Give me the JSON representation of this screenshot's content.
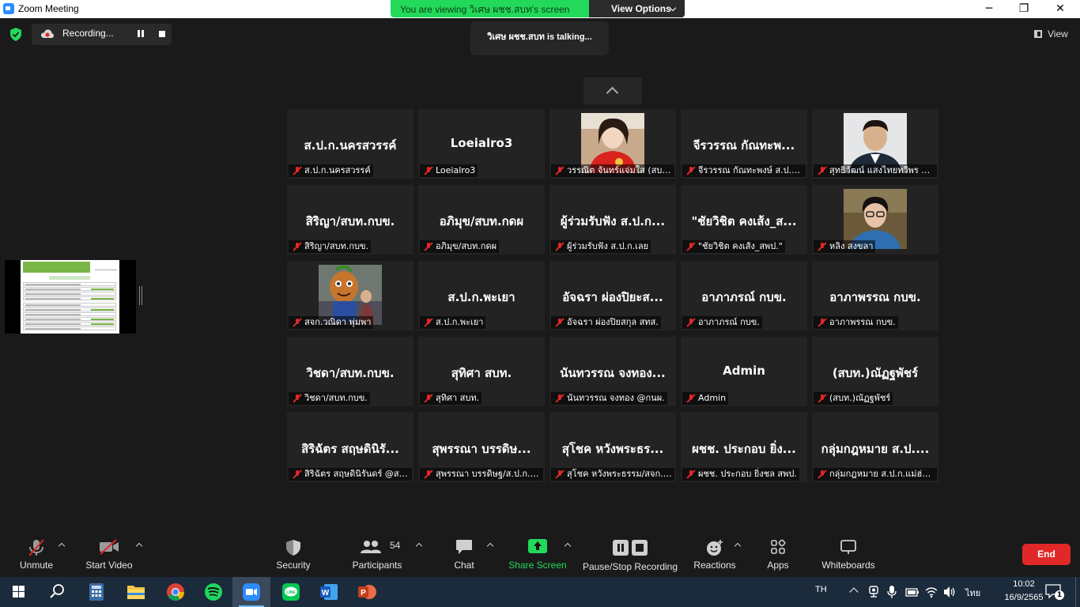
{
  "window": {
    "title": "Zoom Meeting",
    "minimize": "─",
    "restore": "❐",
    "close": "✕"
  },
  "viewing_banner": {
    "message": "You are viewing วิเศษ ผชช.สบท's screen",
    "view_options": "View Options"
  },
  "recording": {
    "label": "Recording..."
  },
  "talking_indicator": "วิเศษ ผชช.สบท is talking...",
  "view_button": "View",
  "participants": [
    {
      "name": "ส.ป.ก.นครสวรรค์",
      "label": "ส.ป.ก.นครสวรรค์",
      "video": false
    },
    {
      "name": "Loeialro3",
      "label": "Loeialro3",
      "video": false
    },
    {
      "name": "",
      "label": "วรรณิต จันทร์แจ่มใส (สบท.สป...",
      "video": true,
      "photo": "red-shirt-woman"
    },
    {
      "name": "จีรวรรณ กัณทะพ...",
      "label": "จีรวรรณ กัณทะพงษ์ ส.ป.ก.เชียง...",
      "video": false
    },
    {
      "name": "",
      "label": "สุทธิวัฒน์ แสงไทยทวีพร ส.ป.ก...",
      "video": true,
      "photo": "man-in-suit"
    },
    {
      "name": "สิริญา/สบท.กบข.",
      "label": "สิริญา/สบท.กบข.",
      "video": false
    },
    {
      "name": "อภิมุข/สบท.กดผ",
      "label": "อภิมุข/สบท.กดผ",
      "video": false
    },
    {
      "name": "ผู้ร่วมรับฟัง ส.ป.ก...",
      "label": "ผู้ร่วมรับฟัง ส.ป.ก.เลย",
      "video": false
    },
    {
      "name": "\"ชัยวิชิต คงเส้ง_ส...",
      "label": "\"ชัยวิชิต คงเส้ง_สพป.\"",
      "video": false
    },
    {
      "name": "",
      "label": "หลิง สงขลา",
      "video": true,
      "photo": "woman-glasses"
    },
    {
      "name": "",
      "label": "สจก.วณิดา พุ่มพา",
      "video": true,
      "photo": "mascot"
    },
    {
      "name": "ส.ป.ก.พะเยา",
      "label": "ส.ป.ก.พะเยา",
      "video": false
    },
    {
      "name": "อัจฉรา ผ่องปิยะส...",
      "label": "อัจฉรา ผ่องปิยสกุล สทส.",
      "video": false
    },
    {
      "name": "อาภาภรณ์ กบข.",
      "label": "อาภาภรณ์ กบข.",
      "video": false
    },
    {
      "name": "อาภาพรรณ กบข.",
      "label": "อาภาพรรณ กบข.",
      "video": false
    },
    {
      "name": "วิชดา/สบท.กบข.",
      "label": "วิชดา/สบท.กบข.",
      "video": false
    },
    {
      "name": "สุทิศา สบท.",
      "label": "สุทิศา สบท.",
      "video": false
    },
    {
      "name": "นันทวรรณ จงทอง...",
      "label": "นันทวรรณ จงทอง @กนผ.",
      "video": false
    },
    {
      "name": "Admin",
      "label": "Admin",
      "video": false
    },
    {
      "name": "(สบท.)ณัฏฐพัชร์",
      "label": "(สบท.)ณัฏฐพัชร์",
      "video": false
    },
    {
      "name": "สิริฉัตร สฤษดินิรั...",
      "label": "สิริฉัตร สฤษดินิรันดร์ @สกส.",
      "video": false
    },
    {
      "name": "สุพรรณา บรรดิษ...",
      "label": "สุพรรณา บรรดิษฐ/ส.ป.ก.ส...",
      "video": false
    },
    {
      "name": "สุโชค หวังพระธร...",
      "label": "สุโชค หวังพระธรรม/สจก.กนผ",
      "video": false
    },
    {
      "name": "ผชช. ประกอบ ยิ่ง...",
      "label": "ผชช. ประกอบ ยิ่งชล สพป.",
      "video": false
    },
    {
      "name": "กลุ่มกฎหมาย ส.ป....",
      "label": "กลุ่มกฎหมาย ส.ป.ก.แม่ฮ่อ...",
      "video": false
    }
  ],
  "toolbar": {
    "unmute": "Unmute",
    "start_video": "Start Video",
    "security": "Security",
    "participants": "Participants",
    "participants_count": "54",
    "chat": "Chat",
    "share_screen": "Share Screen",
    "pause_stop_recording": "Pause/Stop Recording",
    "reactions": "Reactions",
    "apps": "Apps",
    "whiteboards": "Whiteboards",
    "end": "End"
  },
  "taskbar": {
    "apps": [
      "windows-start",
      "search",
      "calculator",
      "file-explorer",
      "chrome",
      "spotify",
      "zoom",
      "line",
      "word",
      "powerpoint"
    ],
    "language": "TH",
    "input_lang": "ไทย",
    "time": "10:02",
    "date": "16/9/2565",
    "notifications": "1"
  },
  "colors": {
    "accent_green": "#23d959",
    "end_red": "#e02828",
    "mic_off_red": "#e02828",
    "share_green": "#23d959"
  }
}
